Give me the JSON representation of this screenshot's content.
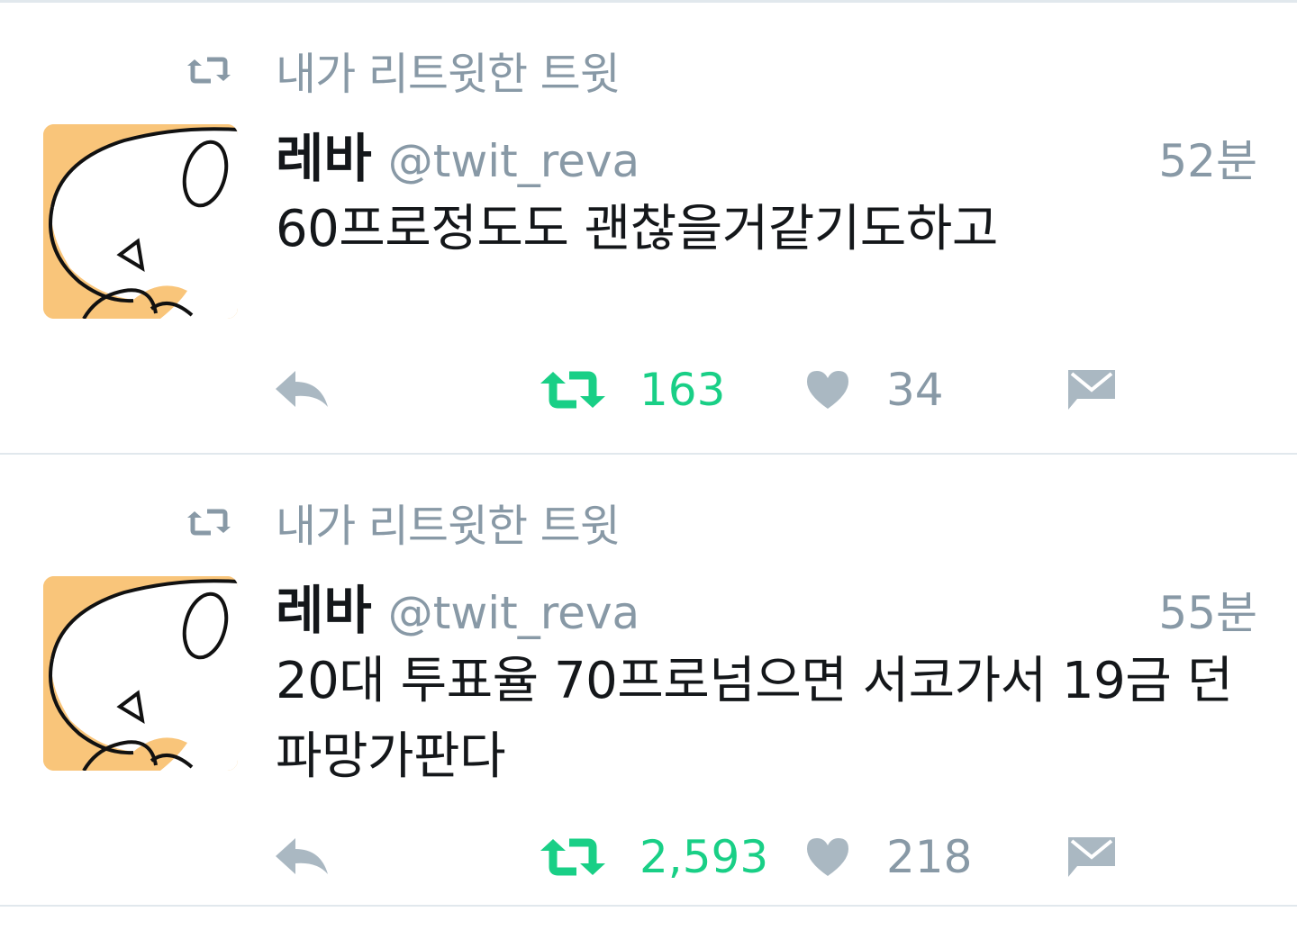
{
  "colors": {
    "muted": "#8899a6",
    "retweeted": "#19cf86",
    "text": "#14171a",
    "divider": "#e1e8ed",
    "avatar_bg": "#f9c57a"
  },
  "icons": {
    "context": "retweet-icon",
    "reply": "reply-icon",
    "retweet": "retweet-icon",
    "like": "heart-icon",
    "dm": "envelope-icon"
  },
  "tweets": [
    {
      "context_label": "내가 리트윗한 트윗",
      "display_name": "레바",
      "screen_name": "@twit_reva",
      "timestamp": "52분",
      "text": "60프로정도도 괜찮을거같기도하고",
      "retweet_count": "163",
      "like_count": "34",
      "retweeted": true
    },
    {
      "context_label": "내가 리트윗한 트윗",
      "display_name": "레바",
      "screen_name": "@twit_reva",
      "timestamp": "55분",
      "text": "20대 투표율 70프로넘으면 서코가서 19금 던파망가판다",
      "retweet_count": "2,593",
      "like_count": "218",
      "retweeted": true
    }
  ]
}
